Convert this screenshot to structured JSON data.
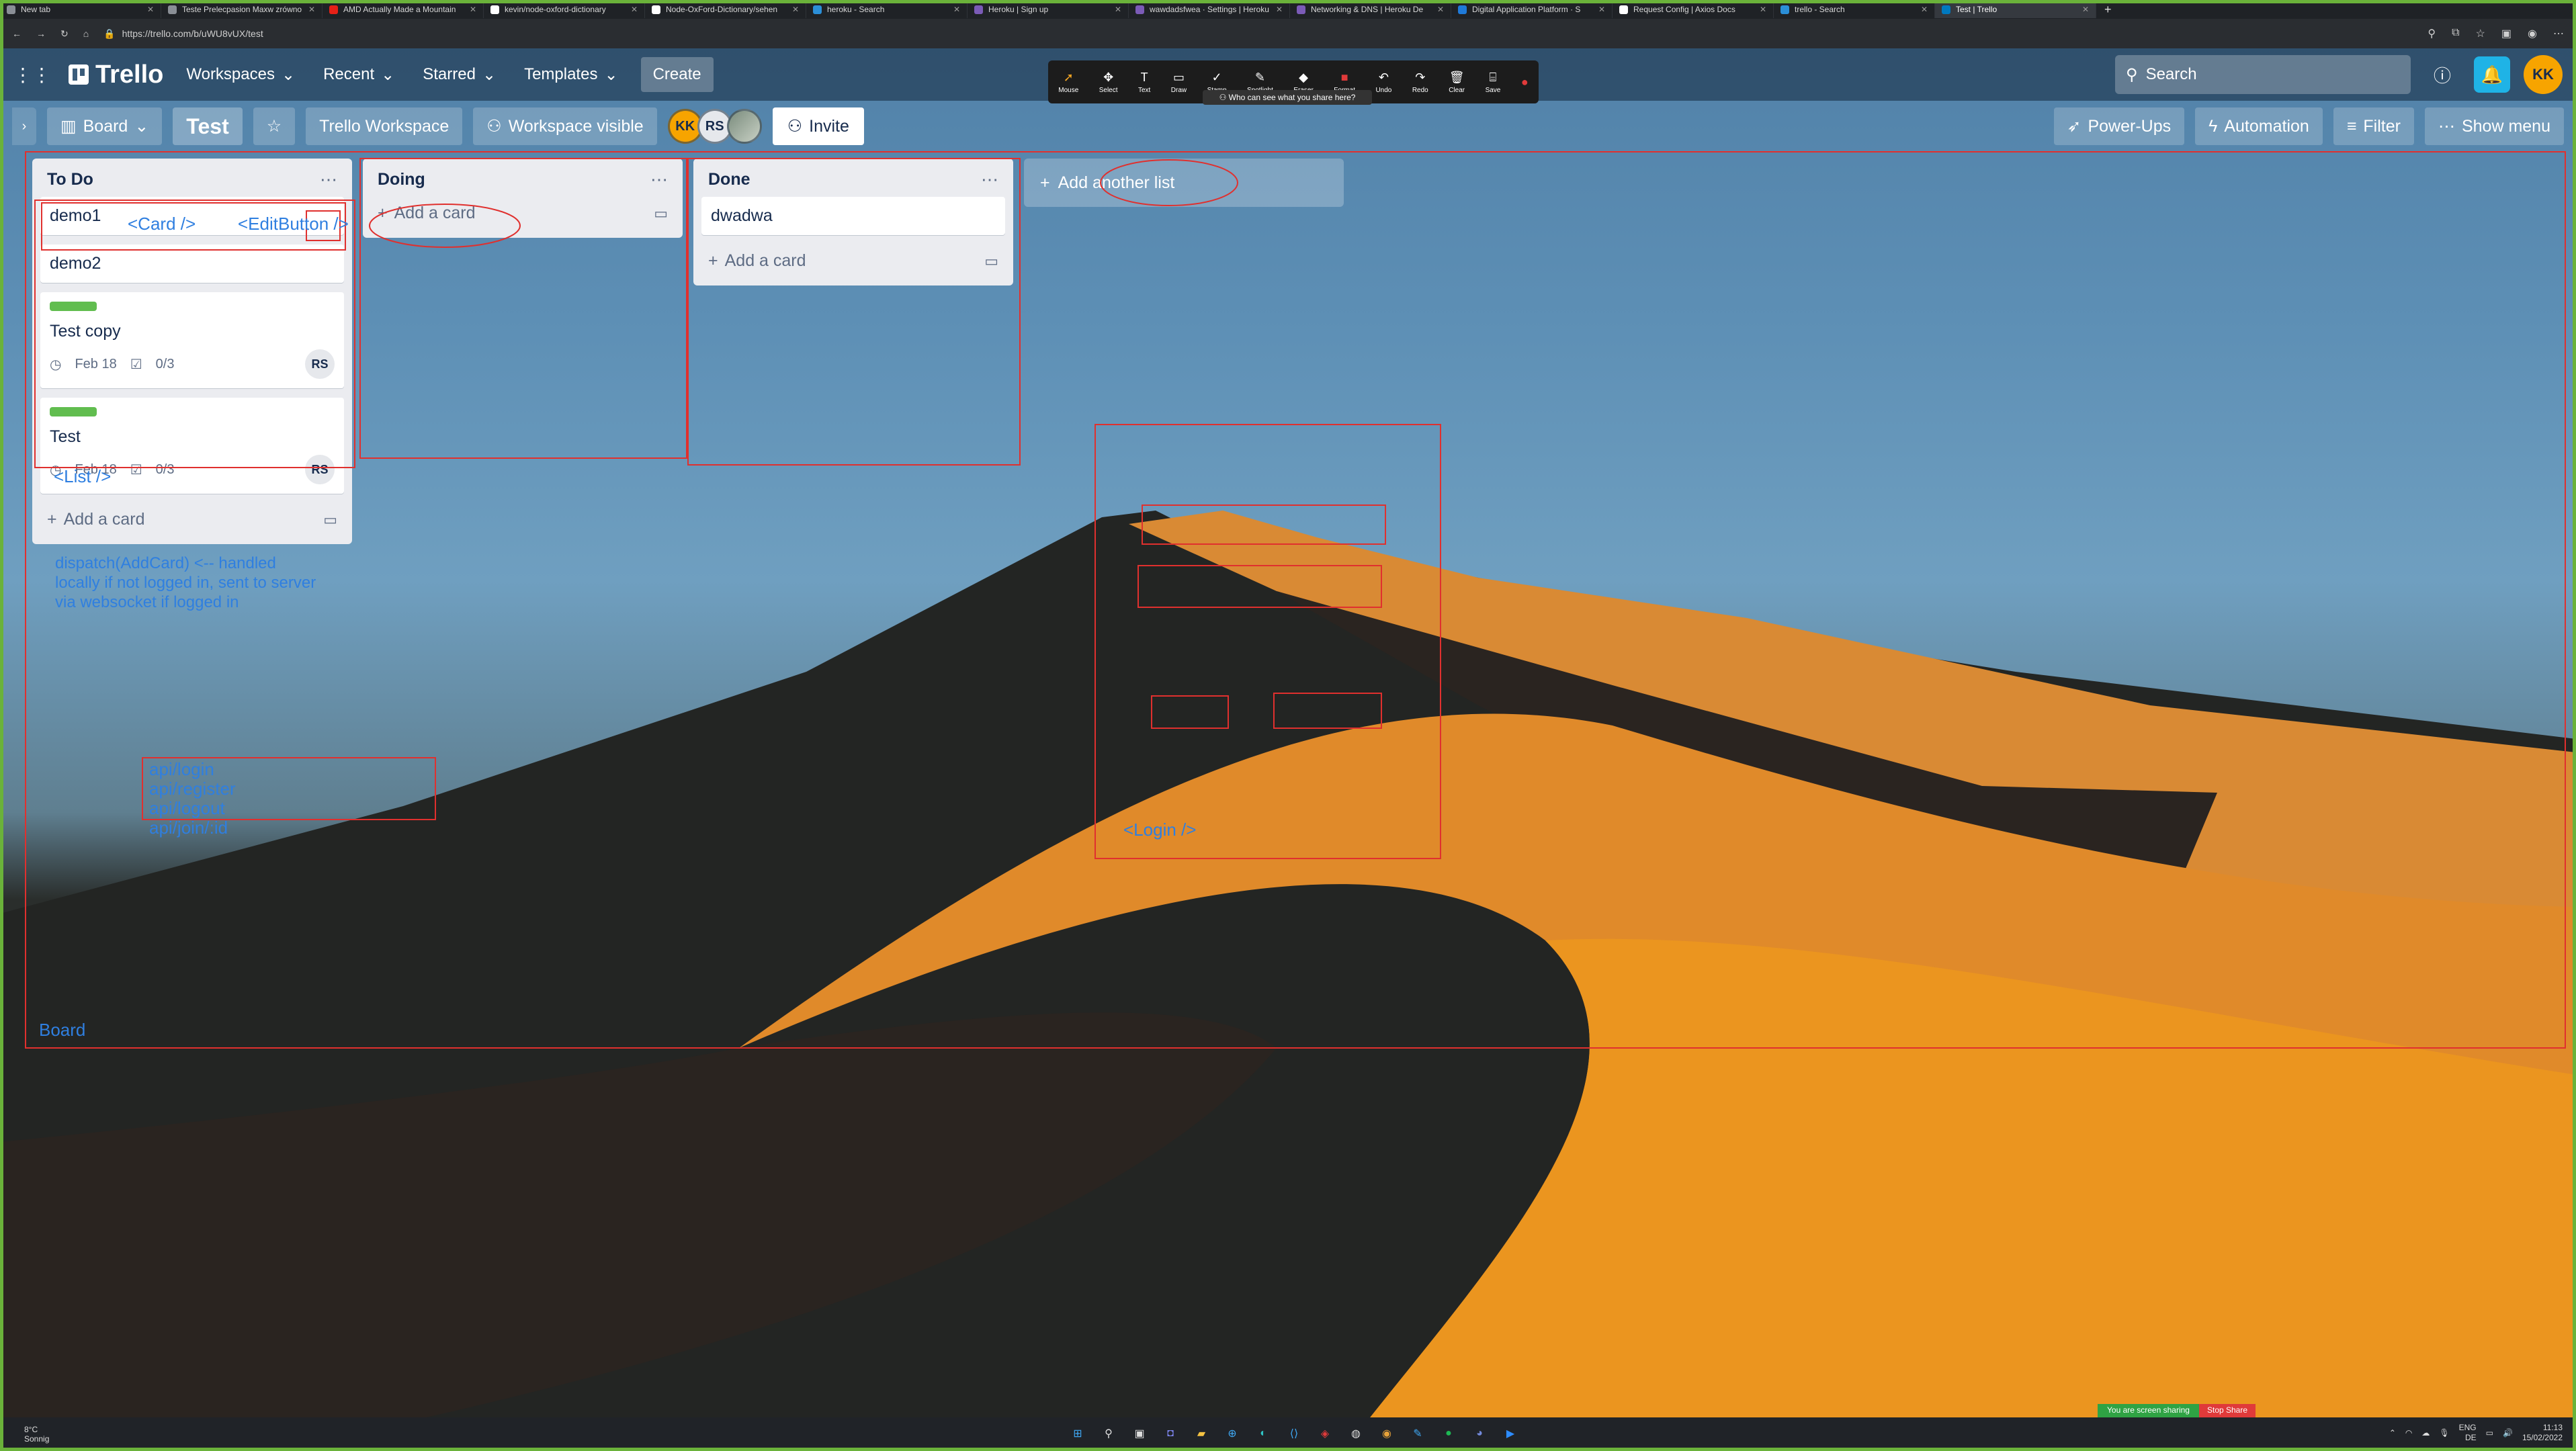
{
  "browser": {
    "tabs": [
      {
        "title": "New tab"
      },
      {
        "title": "Teste Prelecpasion Maxw zrówno"
      },
      {
        "title": "AMD Actually Made a Mountain"
      },
      {
        "title": "kevin/node-oxford-dictionary"
      },
      {
        "title": "Node-OxFord-Dictionary/sehen"
      },
      {
        "title": "heroku - Search"
      },
      {
        "title": "Heroku | Sign up"
      },
      {
        "title": "wawdadsfwea · Settings | Heroku"
      },
      {
        "title": "Networking & DNS | Heroku De"
      },
      {
        "title": "Digital Application Platform · S"
      },
      {
        "title": "Request Config | Axios Docs"
      },
      {
        "title": "trello - Search"
      },
      {
        "title": "Test | Trello"
      }
    ],
    "url": "https://trello.com/b/uWU8vUX/test"
  },
  "header": {
    "logo": "Trello",
    "menus": [
      "Workspaces",
      "Recent",
      "Starred",
      "Templates"
    ],
    "create": "Create",
    "search_placeholder": "Search",
    "avatar": "KK"
  },
  "zoom_toolbar": {
    "tools": [
      "Mouse",
      "Select",
      "Text",
      "Draw",
      "Stamp",
      "Spotlight",
      "Eraser",
      "Format",
      "Undo",
      "Redo",
      "Clear",
      "Save"
    ],
    "note": "Who can see what you share here?"
  },
  "boardbar": {
    "view": "Board",
    "title": "Test",
    "workspace": "Trello Workspace",
    "visibility": "Workspace visible",
    "members": [
      "KK",
      "RS"
    ],
    "invite": "Invite",
    "powerups": "Power-Ups",
    "automation": "Automation",
    "filter": "Filter",
    "show_menu": "Show menu"
  },
  "lists": [
    {
      "title": "To Do",
      "cards": [
        {
          "title": "demo1"
        },
        {
          "title": "demo2"
        },
        {
          "title": "Test copy",
          "date": "Feb 18",
          "checklist": "0/3",
          "member": "RS"
        },
        {
          "title": "Test",
          "date": "Feb 18",
          "checklist": "0/3",
          "member": "RS"
        }
      ],
      "add_card": "Add a card"
    },
    {
      "title": "Doing",
      "cards": [],
      "add_card": "Add a card"
    },
    {
      "title": "Done",
      "cards": [
        {
          "title": "dwadwa"
        }
      ],
      "add_card": "Add a card"
    }
  ],
  "add_list": "Add another list",
  "annotations": {
    "card": "<Card />",
    "edit_button": "<EditButton />",
    "list": "<List />",
    "dispatch": "dispatch(AddCard) <-- handled locally if not logged in, sent to server via websocket if logged in",
    "api": [
      "api/login",
      "api/register",
      "api/logout",
      "api/join/:id"
    ],
    "login": "<Login />",
    "board": "Board"
  },
  "taskbar": {
    "temp": "8°C",
    "weather": "Sonnig",
    "sharing": "You are screen sharing",
    "stop_share": "Stop Share",
    "lang": "ENG",
    "region": "DE",
    "time": "11:13",
    "date": "15/02/2022"
  }
}
